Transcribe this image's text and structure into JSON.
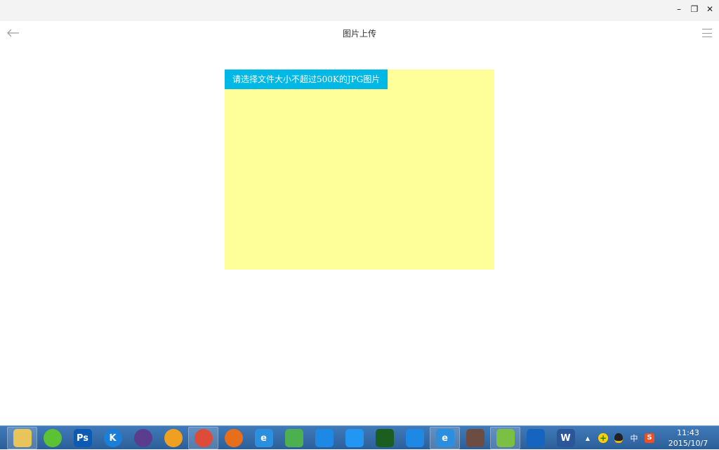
{
  "window": {
    "minimize_glyph": "–",
    "restore_glyph": "❐",
    "close_glyph": "✕"
  },
  "appbar": {
    "title": "图片上传",
    "back_icon": "arrow-left-icon",
    "menu_icon": "hamburger-menu-icon"
  },
  "upload": {
    "button_label": "请选择文件大小不超过500K的JPG图片",
    "area_color": "#ffff99",
    "button_color": "#00b8e6"
  },
  "taskbar": {
    "apps": [
      {
        "name": "file-explorer-icon",
        "glyph": "",
        "color": "#e8c55a"
      },
      {
        "name": "app-green-leaf-icon",
        "glyph": "",
        "color": "#5bc236"
      },
      {
        "name": "photoshop-icon",
        "glyph": "Ps",
        "color": "#0b5bb5"
      },
      {
        "name": "kugou-icon",
        "glyph": "K",
        "color": "#1a7fd8"
      },
      {
        "name": "eclipse-icon",
        "glyph": "",
        "color": "#5b3d8e"
      },
      {
        "name": "app-colorful-ball-icon",
        "glyph": "",
        "color": "#f0a020"
      },
      {
        "name": "chrome-icon",
        "glyph": "",
        "color": "#dd4b39"
      },
      {
        "name": "firefox-icon",
        "glyph": "",
        "color": "#e76f1c"
      },
      {
        "name": "internet-explorer-icon",
        "glyph": "e",
        "color": "#2b8fe0"
      },
      {
        "name": "app-green-arrows-icon",
        "glyph": "",
        "color": "#4caf50"
      },
      {
        "name": "cloud-icon",
        "glyph": "",
        "color": "#1e88e5"
      },
      {
        "name": "baidu-cloud-icon",
        "glyph": "",
        "color": "#2196f3"
      },
      {
        "name": "eye-app-icon",
        "glyph": "",
        "color": "#1b5e20"
      },
      {
        "name": "pen-app-icon",
        "glyph": "",
        "color": "#1e88e5"
      },
      {
        "name": "internet-explorer-2-icon",
        "glyph": "e",
        "color": "#2b8fe0"
      },
      {
        "name": "app-gear-icon",
        "glyph": "",
        "color": "#6d4c41"
      },
      {
        "name": "wechat-icon",
        "glyph": "",
        "color": "#7bc043"
      },
      {
        "name": "remote-desktop-icon",
        "glyph": "",
        "color": "#1565c0"
      },
      {
        "name": "word-icon",
        "glyph": "W",
        "color": "#2b579a"
      }
    ],
    "tray": {
      "up_arrow": "▲",
      "input_method": "中",
      "clock_time": "11:43",
      "clock_date": "2015/10/7"
    }
  }
}
